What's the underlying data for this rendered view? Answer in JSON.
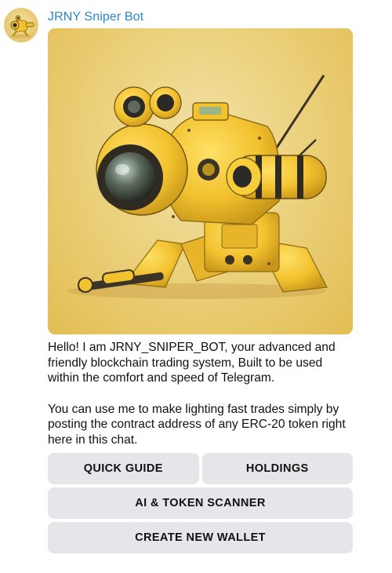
{
  "bot": {
    "name": "JRNY Sniper Bot"
  },
  "message": {
    "paragraph1": "Hello! I am JRNY_SNIPER_BOT, your advanced and friendly blockchain trading system, Built to be used within the comfort and speed of Telegram.",
    "paragraph2": "You can use me to make lighting fast trades simply by posting the contract address of any ERC-20 token right here in this chat."
  },
  "keyboard": {
    "quick_guide": "QUICK GUIDE",
    "holdings": "HOLDINGS",
    "ai_token_scanner": "AI & TOKEN SCANNER",
    "create_new_wallet": "CREATE NEW WALLET"
  },
  "colors": {
    "sender_name": "#2a86c8",
    "button_bg": "#e5e5ea",
    "image_accent": "#f2c12e"
  },
  "icons": {
    "avatar": "robot-avatar",
    "media": "yellow-robot-illustration"
  }
}
